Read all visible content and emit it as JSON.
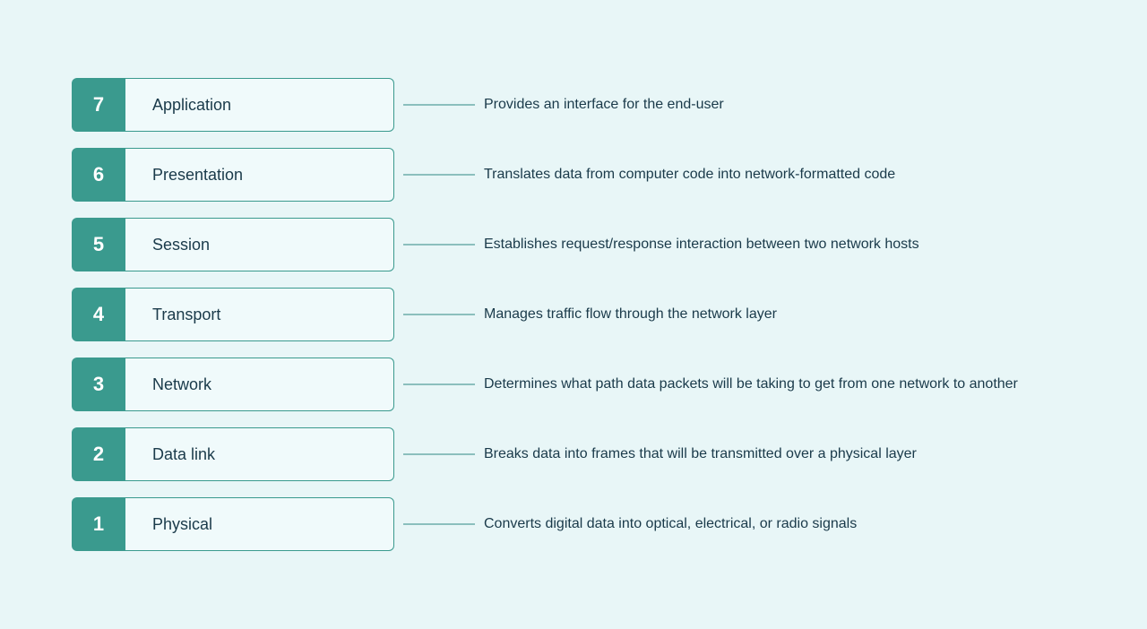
{
  "layers": [
    {
      "number": "7",
      "name": "Application",
      "description": "Provides an interface for the end-user"
    },
    {
      "number": "6",
      "name": "Presentation",
      "description": "Translates data from computer code into network-formatted code"
    },
    {
      "number": "5",
      "name": "Session",
      "description": "Establishes request/response interaction between two network hosts"
    },
    {
      "number": "4",
      "name": "Transport",
      "description": "Manages traffic flow through the network layer"
    },
    {
      "number": "3",
      "name": "Network",
      "description": "Determines what path data packets will be taking to get from one network to another"
    },
    {
      "number": "2",
      "name": "Data link",
      "description": "Breaks data into frames that will be transmitted over a physical layer"
    },
    {
      "number": "1",
      "name": "Physical",
      "description": "Converts digital data into optical, electrical, or radio signals"
    }
  ]
}
